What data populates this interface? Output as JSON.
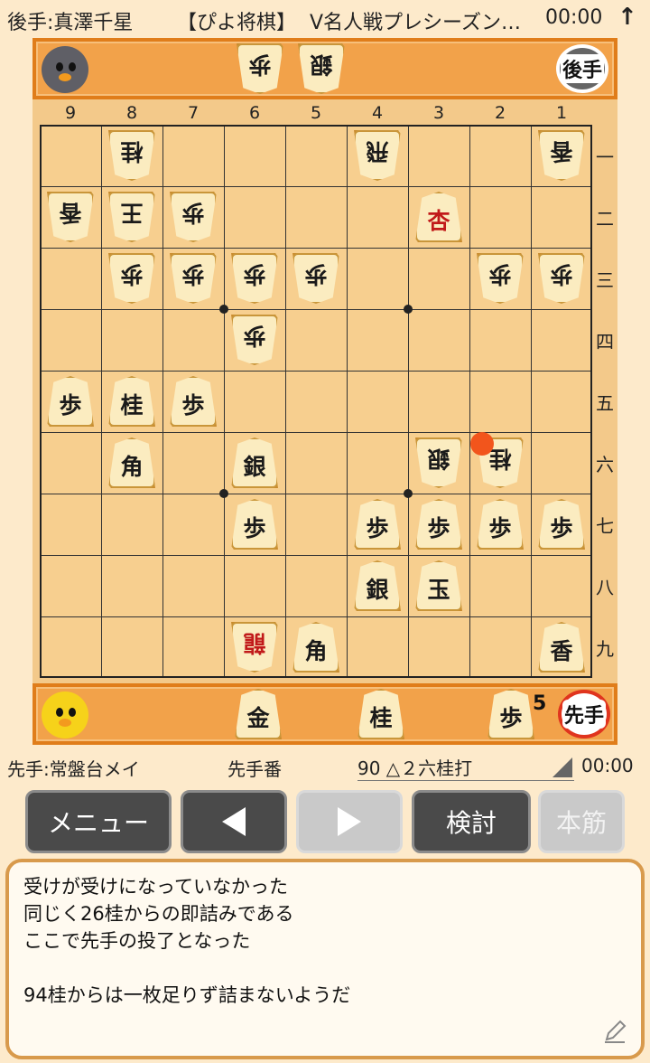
{
  "titlebar": {
    "gote_player": "後手:真澤千星",
    "app_name": "【ぴよ将棋】",
    "event": "V名人戦プレシーズン…",
    "clock": "00:00",
    "arrow": "↑"
  },
  "gote_hand": {
    "badge": "後手",
    "pieces": [
      {
        "kanji": "歩",
        "label": "gote-hand-pawn"
      },
      {
        "kanji": "銀",
        "label": "gote-hand-silver"
      }
    ]
  },
  "sente_hand": {
    "badge": "先手",
    "pieces": [
      {
        "kanji": "金",
        "count": ""
      },
      {
        "kanji": "桂",
        "count": ""
      },
      {
        "kanji": "歩",
        "count": "5"
      }
    ]
  },
  "board": {
    "files": [
      "9",
      "8",
      "7",
      "6",
      "5",
      "4",
      "3",
      "2",
      "1"
    ],
    "ranks": [
      "一",
      "二",
      "三",
      "四",
      "五",
      "六",
      "七",
      "八",
      "九"
    ],
    "pieces": [
      {
        "file": 8,
        "rank": 1,
        "kanji": "桂",
        "side": "gote"
      },
      {
        "file": 4,
        "rank": 1,
        "kanji": "飛",
        "side": "gote"
      },
      {
        "file": 1,
        "rank": 1,
        "kanji": "香",
        "side": "gote"
      },
      {
        "file": 9,
        "rank": 2,
        "kanji": "香",
        "side": "gote"
      },
      {
        "file": 8,
        "rank": 2,
        "kanji": "王",
        "side": "gote"
      },
      {
        "file": 7,
        "rank": 2,
        "kanji": "歩",
        "side": "gote"
      },
      {
        "file": 3,
        "rank": 2,
        "kanji": "杏",
        "side": "sente",
        "promoted": true
      },
      {
        "file": 8,
        "rank": 3,
        "kanji": "歩",
        "side": "gote"
      },
      {
        "file": 7,
        "rank": 3,
        "kanji": "歩",
        "side": "gote"
      },
      {
        "file": 6,
        "rank": 3,
        "kanji": "歩",
        "side": "gote"
      },
      {
        "file": 5,
        "rank": 3,
        "kanji": "歩",
        "side": "gote"
      },
      {
        "file": 2,
        "rank": 3,
        "kanji": "歩",
        "side": "gote"
      },
      {
        "file": 1,
        "rank": 3,
        "kanji": "歩",
        "side": "gote"
      },
      {
        "file": 6,
        "rank": 4,
        "kanji": "歩",
        "side": "gote"
      },
      {
        "file": 9,
        "rank": 5,
        "kanji": "歩",
        "side": "sente"
      },
      {
        "file": 8,
        "rank": 5,
        "kanji": "桂",
        "side": "sente"
      },
      {
        "file": 7,
        "rank": 5,
        "kanji": "歩",
        "side": "sente"
      },
      {
        "file": 8,
        "rank": 6,
        "kanji": "角",
        "side": "sente"
      },
      {
        "file": 6,
        "rank": 6,
        "kanji": "銀",
        "side": "sente"
      },
      {
        "file": 3,
        "rank": 6,
        "kanji": "銀",
        "side": "gote"
      },
      {
        "file": 2,
        "rank": 6,
        "kanji": "桂",
        "side": "gote"
      },
      {
        "file": 6,
        "rank": 7,
        "kanji": "歩",
        "side": "sente"
      },
      {
        "file": 4,
        "rank": 7,
        "kanji": "歩",
        "side": "sente"
      },
      {
        "file": 3,
        "rank": 7,
        "kanji": "歩",
        "side": "sente"
      },
      {
        "file": 2,
        "rank": 7,
        "kanji": "歩",
        "side": "sente"
      },
      {
        "file": 1,
        "rank": 7,
        "kanji": "歩",
        "side": "sente"
      },
      {
        "file": 4,
        "rank": 8,
        "kanji": "銀",
        "side": "sente"
      },
      {
        "file": 3,
        "rank": 8,
        "kanji": "玉",
        "side": "sente"
      },
      {
        "file": 6,
        "rank": 9,
        "kanji": "龍",
        "side": "gote",
        "promoted": true
      },
      {
        "file": 5,
        "rank": 9,
        "kanji": "角",
        "side": "sente"
      },
      {
        "file": 1,
        "rank": 9,
        "kanji": "香",
        "side": "sente"
      }
    ],
    "last_move_square": {
      "file": 2,
      "rank": 6
    }
  },
  "info": {
    "sente_player": "先手:常盤台メイ",
    "turn": "先手番",
    "move": "90 △２六桂打",
    "clock": "00:00"
  },
  "buttons": {
    "menu": "メニュー",
    "prev_icon": "left-triangle-icon",
    "next_icon": "right-triangle-icon",
    "analyze": "検討",
    "mainline": "本筋"
  },
  "comment": {
    "lines": [
      "受けが受けになっていなかった",
      "同じく26桂からの即詰みである",
      "ここで先手の投了となった",
      "",
      "94桂からは一枚足りず詰まないようだ"
    ]
  },
  "colors": {
    "background": "#fdeacb",
    "hand_bar": "#f2a24a",
    "board": "#f7cf8f",
    "promoted_red": "#c11a1a",
    "last_move_marker": "#f2551c",
    "button_dark": "#4a4a4a"
  }
}
